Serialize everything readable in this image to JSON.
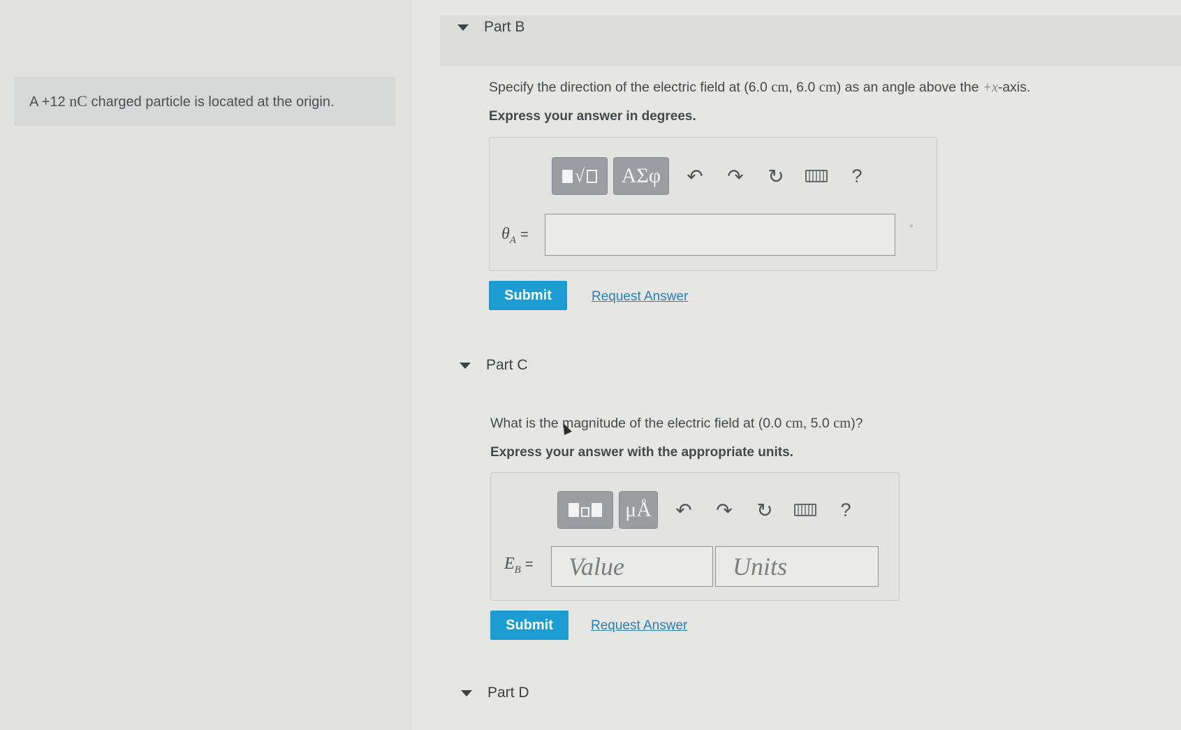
{
  "intro": {
    "text_prefix": "A +12 ",
    "unit": "nC",
    "text_suffix": " charged particle is located at the origin."
  },
  "parts": {
    "b": {
      "title": "Part B",
      "question_prefix": "Specify the direction of the electric field at (6.0 ",
      "q_unit1": "cm",
      "q_mid": ", 6.0 ",
      "q_unit2": "cm",
      "q_after": ") as an angle above the ",
      "q_axis": "+x",
      "q_end": "-axis.",
      "instruction": "Express your answer in degrees.",
      "toolbar": {
        "greek_label": "ΑΣφ",
        "help_label": "?"
      },
      "var_symbol": "θ",
      "var_sub": "A",
      "var_eq": "=",
      "degree_unit": "°",
      "submit_label": "Submit",
      "request_label": "Request Answer"
    },
    "c": {
      "title": "Part C",
      "question_prefix": "What is the magnitude of the electric field at (0.0 ",
      "q_unit1": "cm",
      "q_mid": ", 5.0 ",
      "q_unit2": "cm",
      "q_end": ")?",
      "instruction": "Express your answer with the appropriate units.",
      "toolbar": {
        "units_label": "μÅ",
        "help_label": "?"
      },
      "var_symbol": "E",
      "var_sub": "B",
      "var_eq": "=",
      "value_placeholder": "Value",
      "units_placeholder": "Units",
      "submit_label": "Submit",
      "request_label": "Request Answer"
    },
    "d": {
      "title": "Part D"
    }
  },
  "icons": {
    "undo": "undo-icon",
    "redo": "redo-icon",
    "reset": "reset-icon",
    "keyboard": "keyboard-icon",
    "help": "help-icon"
  },
  "colors": {
    "submit": "#1d9cd1",
    "link": "#2a7eb1",
    "toolbar_button": "#9a9ea1"
  }
}
